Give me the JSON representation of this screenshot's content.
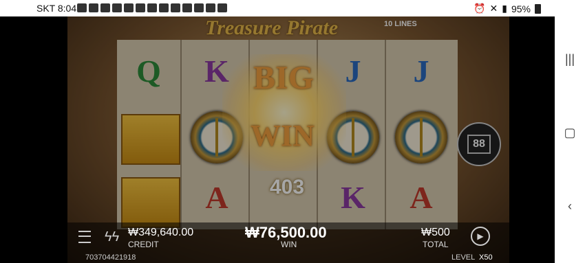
{
  "statusbar": {
    "carrier_time": "SKT 8:04",
    "battery": "95%"
  },
  "game": {
    "title": "Treasure Pirate",
    "lines_label": "10 LINES",
    "big_text": "BIG",
    "win_text": "WIN",
    "win_amount_overlay": "403",
    "bonus_count": "88",
    "reels": [
      [
        "Q",
        "gold",
        "gold"
      ],
      [
        "K",
        "compass",
        "A"
      ],
      [
        "",
        "",
        ""
      ],
      [
        "J",
        "compass",
        "K"
      ],
      [
        "J",
        "compass",
        "A"
      ]
    ]
  },
  "bottom": {
    "credit_value": "₩349,640.00",
    "credit_label": "CREDIT",
    "win_value": "₩76,500.00",
    "win_label": "WIN",
    "total_value": "₩500",
    "total_label": "TOTAL",
    "session_id": "703704421918",
    "level_label": "LEVEL",
    "level_value": "X50"
  }
}
